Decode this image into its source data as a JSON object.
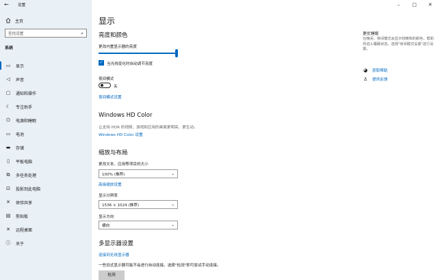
{
  "window": {
    "title": "设置",
    "controls": [
      "–",
      "□",
      "✕"
    ]
  },
  "sidebar": {
    "home": "主页",
    "search_placeholder": "查找设置",
    "section": "系统",
    "items": [
      {
        "label": "显示",
        "icon": "monitor-icon",
        "glyph": "▭",
        "active": true
      },
      {
        "label": "声音",
        "icon": "speaker-icon",
        "glyph": "◁",
        "active": false
      },
      {
        "label": "通知和操作",
        "icon": "notification-icon",
        "glyph": "▢",
        "active": false
      },
      {
        "label": "专注助手",
        "icon": "moon-icon",
        "glyph": "☾",
        "active": false
      },
      {
        "label": "电源和睡眠",
        "icon": "power-icon",
        "glyph": "⏻",
        "active": false
      },
      {
        "label": "电池",
        "icon": "battery-icon",
        "glyph": "▭",
        "active": false
      },
      {
        "label": "存储",
        "icon": "storage-icon",
        "glyph": "▬",
        "active": false
      },
      {
        "label": "平板电脑",
        "icon": "tablet-icon",
        "glyph": "▯",
        "active": false
      },
      {
        "label": "多任务处理",
        "icon": "multitask-icon",
        "glyph": "⧉",
        "active": false
      },
      {
        "label": "投影到此电脑",
        "icon": "project-icon",
        "glyph": "⊡",
        "active": false
      },
      {
        "label": "体验共享",
        "icon": "share-icon",
        "glyph": "✕",
        "active": false
      },
      {
        "label": "剪贴板",
        "icon": "clipboard-icon",
        "glyph": "▤",
        "active": false
      },
      {
        "label": "远程桌面",
        "icon": "remote-icon",
        "glyph": "✕",
        "active": false
      },
      {
        "label": "关于",
        "icon": "info-icon",
        "glyph": "ⓘ",
        "active": false
      }
    ]
  },
  "main": {
    "title": "显示",
    "brightness": {
      "heading": "亮度和颜色",
      "label": "更改内置显示器的亮度",
      "level_percent": 100,
      "auto_label": "当光线变化时自动调节亮度",
      "auto_checked": true
    },
    "night": {
      "label": "夜间模式",
      "state": "关",
      "link": "夜间模式设置"
    },
    "hdr": {
      "heading": "Windows HD Color",
      "desc": "让支持 HDR 的视频、游戏和应用的画面更明亮、更生动。",
      "link": "Windows HD Color 设置"
    },
    "scale": {
      "heading": "缩放与布局",
      "size_label": "更改文本、应用等项目的大小",
      "size_value": "100% (推荐)",
      "adv_link": "高级缩放设置",
      "res_label": "显示分辨率",
      "res_value": "1536 × 1024 (推荐)",
      "orient_label": "显示方向",
      "orient_value": "横向"
    },
    "multi": {
      "heading": "多显示器设置",
      "link": "连接到无线显示器",
      "desc": "一些旧式显示器可能不会进行自动连接。选择\"检测\"即可尝试手动连接。",
      "detect": "检测"
    }
  },
  "right": {
    "title": "更优睡眠",
    "desc": "在晚间，夜间模式会显示较暖和的颜色，帮助你进入睡眠状态。选择\"夜间模式设置\"进行设置。",
    "help": "获取帮助",
    "feedback": "提供反馈"
  },
  "colors": {
    "accent": "#0067c0",
    "sidebar_bg": "#e9f0f6"
  }
}
